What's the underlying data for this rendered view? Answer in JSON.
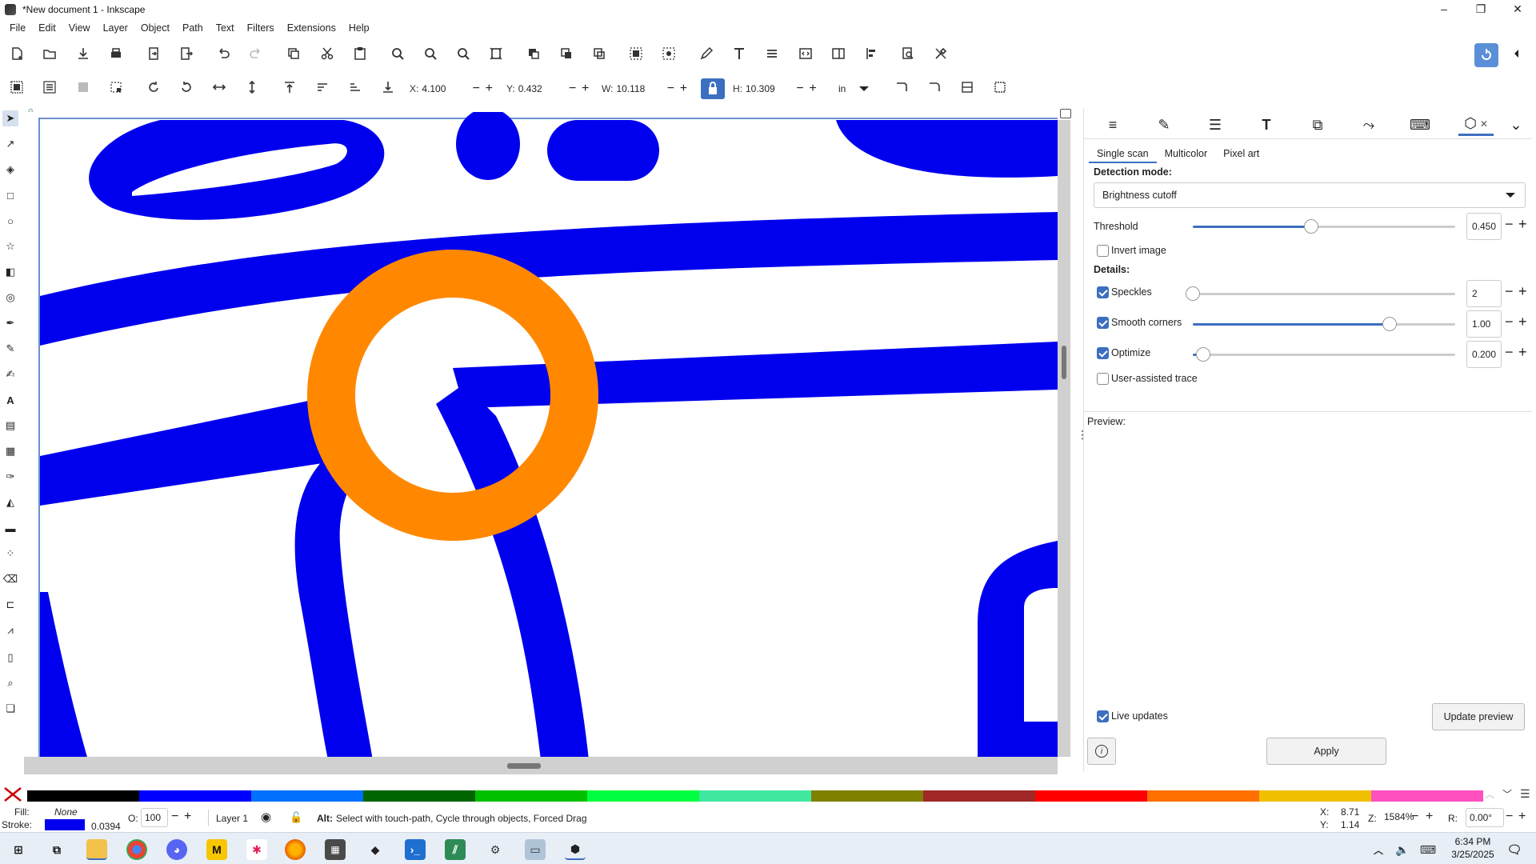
{
  "window": {
    "title": "*New document 1 - Inkscape",
    "controls": [
      "–",
      "❐",
      "✕"
    ]
  },
  "menu": [
    "File",
    "Edit",
    "View",
    "Layer",
    "Object",
    "Path",
    "Text",
    "Filters",
    "Extensions",
    "Help"
  ],
  "toolcontrols": {
    "x_label": "X:",
    "x_value": "4.100",
    "y_label": "Y:",
    "y_value": "0.432",
    "w_label": "W:",
    "w_value": "10.118",
    "h_label": "H:",
    "h_value": "10.309",
    "unit": "in"
  },
  "dock": {
    "subtabs": [
      "Single scan",
      "Multicolor",
      "Pixel art"
    ],
    "detection_mode_label": "Detection mode:",
    "detection_mode_value": "Brightness cutoff",
    "threshold_label": "Threshold",
    "threshold_value": "0.450",
    "invert_label": "Invert image",
    "details_label": "Details:",
    "speckles_label": "Speckles",
    "speckles_value": "2",
    "smooth_label": "Smooth corners",
    "smooth_value": "1.00",
    "optimize_label": "Optimize",
    "optimize_value": "0.200",
    "user_assisted_label": "User-assisted trace",
    "preview_label": "Preview:",
    "live_updates_label": "Live updates",
    "update_preview_label": "Update preview",
    "apply_label": "Apply",
    "threshold_level": 0.45,
    "speckles_level": 0.0,
    "smooth_level": 0.75,
    "optimize_level": 0.04
  },
  "status": {
    "fill_label": "Fill:",
    "fill_value": "None",
    "stroke_label": "Stroke:",
    "stroke_width": "0.0394",
    "opacity_label": "O:",
    "opacity_value": "100",
    "layer_name": "Layer 1",
    "message_bold": "Alt:",
    "message": "Select with touch-path, Cycle through objects, Forced Drag",
    "x_label": "X:",
    "x_value": "8.71",
    "y_label": "Y:",
    "y_value": "1.14",
    "zoom_label": "Z:",
    "zoom_value": "1584%",
    "rotate_label": "R:",
    "rotate_value": "0.00°"
  },
  "taskbar": {
    "time": "6:34 PM",
    "date": "3/25/2025"
  },
  "colors": {
    "accent": "#3d6fc0",
    "blue_shape": "#0000ee",
    "orange_ring": "#ff8800"
  },
  "palette": [
    "#000000",
    "#0000ff",
    "#0070ff",
    "#006400",
    "#00c000",
    "#00ff40",
    "#40e8a0",
    "#808000",
    "#a02828",
    "#ff0000",
    "#ff7000",
    "#f0c000",
    "#ff50c0"
  ]
}
